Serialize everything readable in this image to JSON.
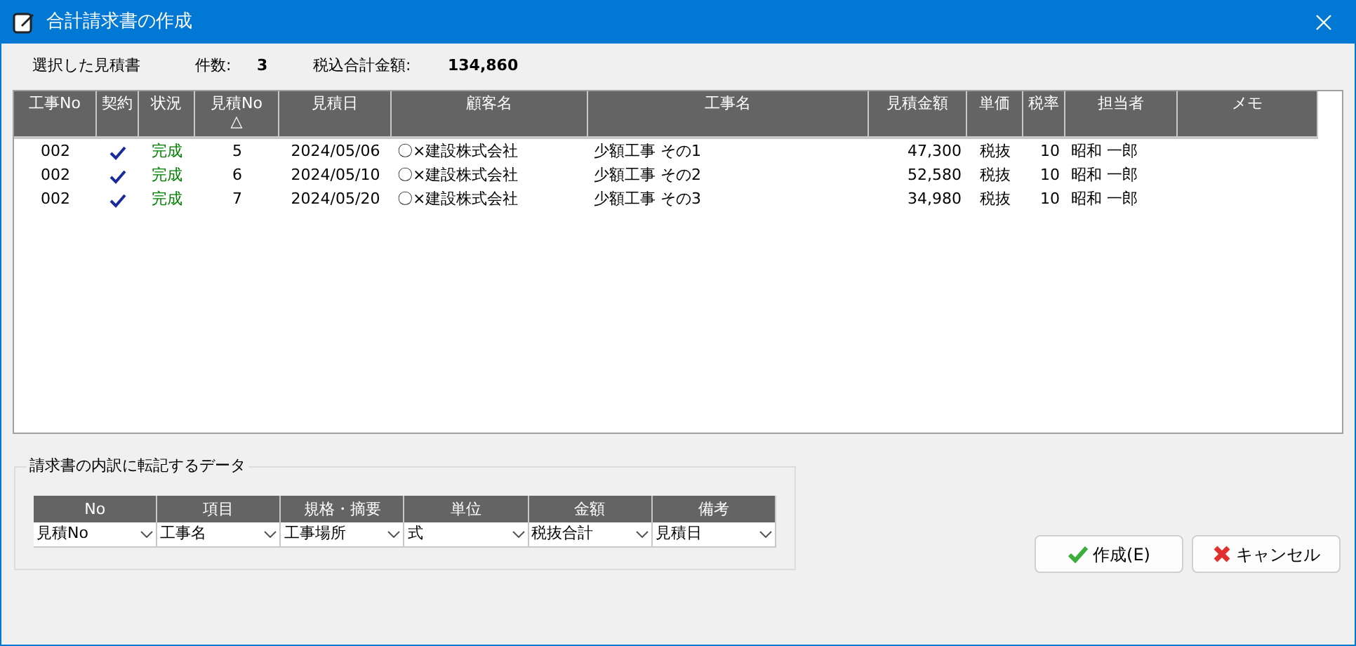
{
  "window": {
    "title": "合計請求書の作成"
  },
  "summary": {
    "label": "選択した見積書",
    "count_label": "件数:",
    "count": "3",
    "total_label": "税込合計金額:",
    "total": "134,860"
  },
  "table": {
    "columns": [
      {
        "label": "工事No"
      },
      {
        "label": "契約"
      },
      {
        "label": "状況"
      },
      {
        "label": "見積No",
        "sort_mark": "△"
      },
      {
        "label": "見積日"
      },
      {
        "label": "顧客名"
      },
      {
        "label": "工事名"
      },
      {
        "label": "見積金額"
      },
      {
        "label": "単価"
      },
      {
        "label": "税率"
      },
      {
        "label": "担当者"
      },
      {
        "label": "メモ"
      }
    ],
    "rows": [
      {
        "project_no": "002",
        "contracted": true,
        "status": "完成",
        "estimate_no": "5",
        "date": "2024/05/06",
        "customer": "〇×建設株式会社",
        "project": "少額工事 その1",
        "amount": "47,300",
        "unit_price": "税抜",
        "tax_rate": "10",
        "person": "昭和 一郎"
      },
      {
        "project_no": "002",
        "contracted": true,
        "status": "完成",
        "estimate_no": "6",
        "date": "2024/05/10",
        "customer": "〇×建設株式会社",
        "project": "少額工事 その2",
        "amount": "52,580",
        "unit_price": "税抜",
        "tax_rate": "10",
        "person": "昭和 一郎"
      },
      {
        "project_no": "002",
        "contracted": true,
        "status": "完成",
        "estimate_no": "7",
        "date": "2024/05/20",
        "customer": "〇×建設株式会社",
        "project": "少額工事 その3",
        "amount": "34,980",
        "unit_price": "税抜",
        "tax_rate": "10",
        "person": "昭和 一郎"
      }
    ]
  },
  "transfer": {
    "title": "請求書の内訳に転記するデータ",
    "fields": [
      {
        "label": "No",
        "value": "見積No"
      },
      {
        "label": "項目",
        "value": "工事名"
      },
      {
        "label": "規格・摘要",
        "value": "工事場所"
      },
      {
        "label": "単位",
        "value": "式"
      },
      {
        "label": "金額",
        "value": "税抜合計"
      },
      {
        "label": "備考",
        "value": "見積日"
      }
    ]
  },
  "buttons": [
    {
      "kind": "ok",
      "label": "作成(E)"
    },
    {
      "kind": "cancel",
      "label": "キャンセル"
    }
  ]
}
